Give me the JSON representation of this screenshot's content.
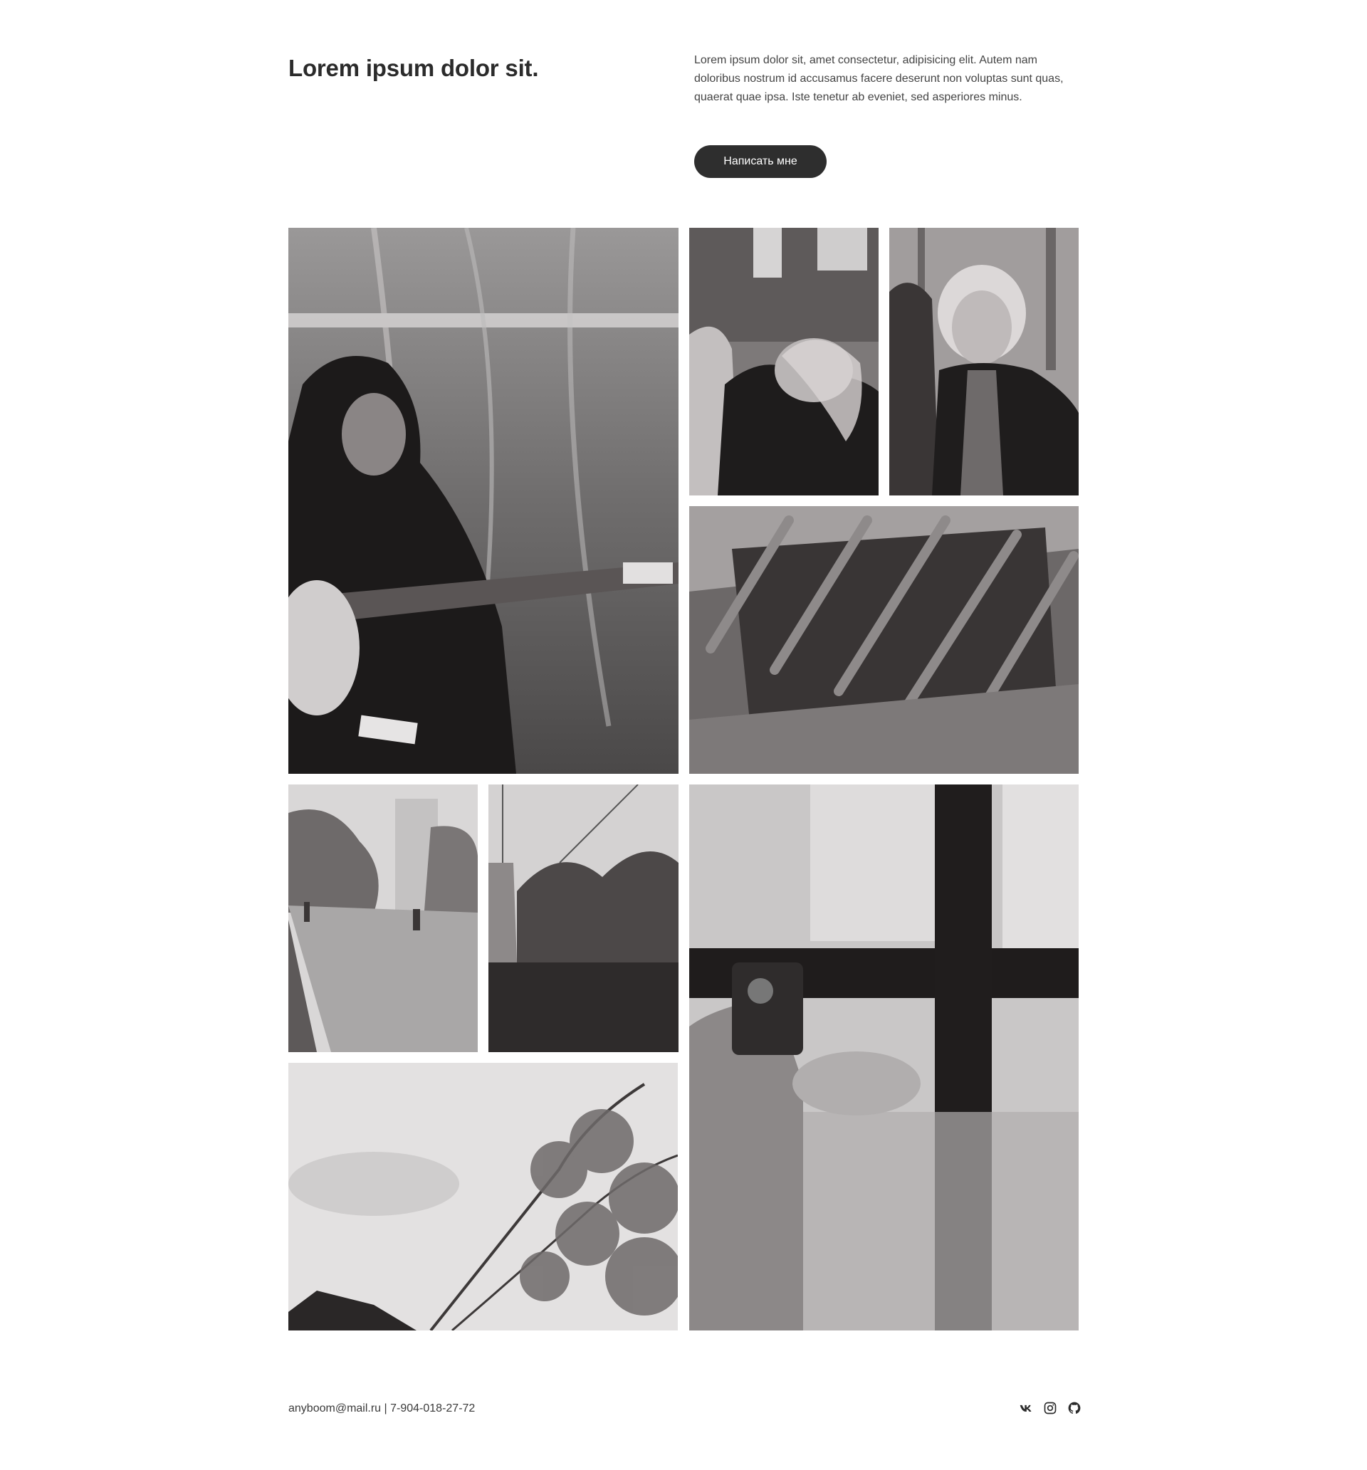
{
  "header": {
    "title": "Lorem ipsum dolor sit.",
    "intro": "Lorem ipsum dolor sit, amet consectetur, adipisicing elit. Autem nam doloribus nostrum id accusamus facere deserunt non voluptas sunt quas, quaerat quae ipsa. Iste tenetur ab eveniet, sed asperiores minus.",
    "cta_label": "Написать мне"
  },
  "gallery": {
    "photos": [
      {
        "subject": "guitarist"
      },
      {
        "subject": "friends-looking-down"
      },
      {
        "subject": "portrait-with-glasses"
      },
      {
        "subject": "grate"
      },
      {
        "subject": "street-with-cyclist"
      },
      {
        "subject": "garden-house"
      },
      {
        "subject": "window-reflection"
      },
      {
        "subject": "tree-branches"
      }
    ]
  },
  "footer": {
    "contact": "anyboom@mail.ru | 7-904-018-27-72",
    "socials": [
      "vk-icon",
      "instagram-icon",
      "github-icon"
    ]
  },
  "colors": {
    "text": "#2b2b2b",
    "button_bg": "#2e2e2e",
    "button_text": "#ffffff",
    "background": "#ffffff"
  }
}
